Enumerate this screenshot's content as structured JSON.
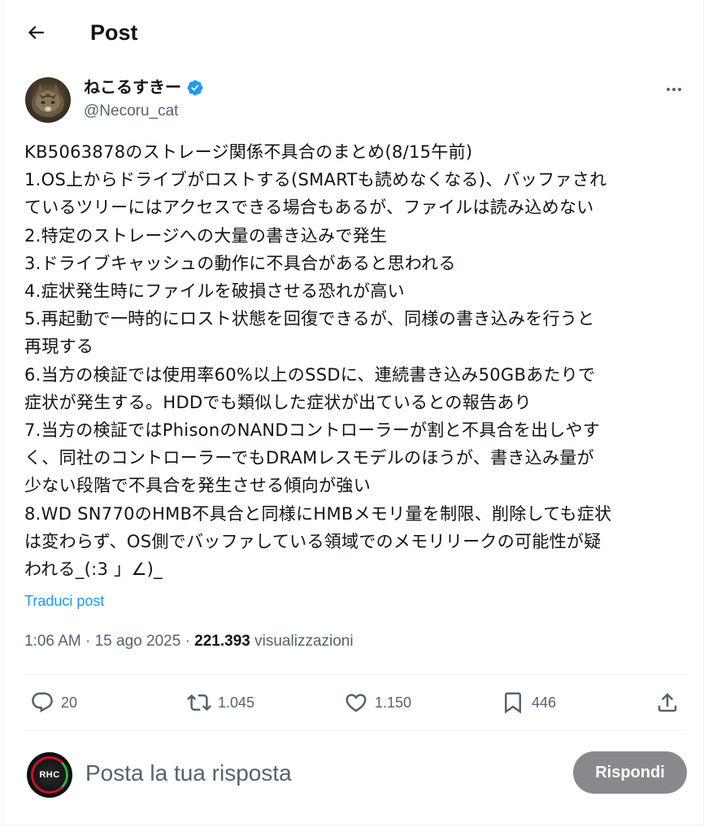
{
  "header": {
    "title": "Post"
  },
  "author": {
    "name": "ねこるすきー",
    "handle": "@Necoru_cat"
  },
  "tweet": {
    "lines": [
      "KB5063878のストレージ関係不具合のまとめ(8/15午前)",
      "1.OS上からドライブがロストする(SMARTも読めなくなる)、バッファされ",
      "ているツリーにはアクセスできる場合もあるが、ファイルは読み込めない",
      "2.特定のストレージへの大量の書き込みで発生",
      "3.ドライブキャッシュの動作に不具合があると思われる",
      "4.症状発生時にファイルを破損させる恐れが高い",
      "5.再起動で一時的にロスト状態を回復できるが、同様の書き込みを行うと",
      "再現する",
      "6.当方の検証では使用率60%以上のSSDに、連続書き込み50GBあたりで",
      "症状が発生する。HDDでも類似した症状が出ているとの報告あり",
      "7.当方の検証ではPhisonのNANDコントローラーが割と不具合を出しやす",
      "く、同社のコントローラーでもDRAMレスモデルのほうが、書き込み量が",
      "少ない段階で不具合を発生させる傾向が強い",
      "8.WD SN770のHMB不具合と同様にHMBメモリ量を制限、削除しても症状",
      "は変わらず、OS側でバッファしている領域でのメモリリークの可能性が疑",
      "われる_(:3 」∠)_"
    ],
    "translate_label": "Traduci post",
    "time": "1:06 AM",
    "date": "15 ago 2025",
    "separator": "·",
    "views_count": "221.393",
    "views_label": "visualizzazioni"
  },
  "actions": {
    "replies": "20",
    "reposts": "1.045",
    "likes": "1.150",
    "bookmarks": "446"
  },
  "reply_box": {
    "placeholder": "Posta la tua risposta",
    "avatar_text": "RHC",
    "button_label": "Rispondi"
  },
  "colors": {
    "accent": "#1d9bf0",
    "secondary_text": "#536471",
    "reply_button": "#87898c"
  },
  "icons": [
    "arrow-left-icon",
    "verified-badge-icon",
    "more-icon",
    "reply-icon",
    "repost-icon",
    "like-icon",
    "bookmark-icon",
    "share-icon"
  ]
}
